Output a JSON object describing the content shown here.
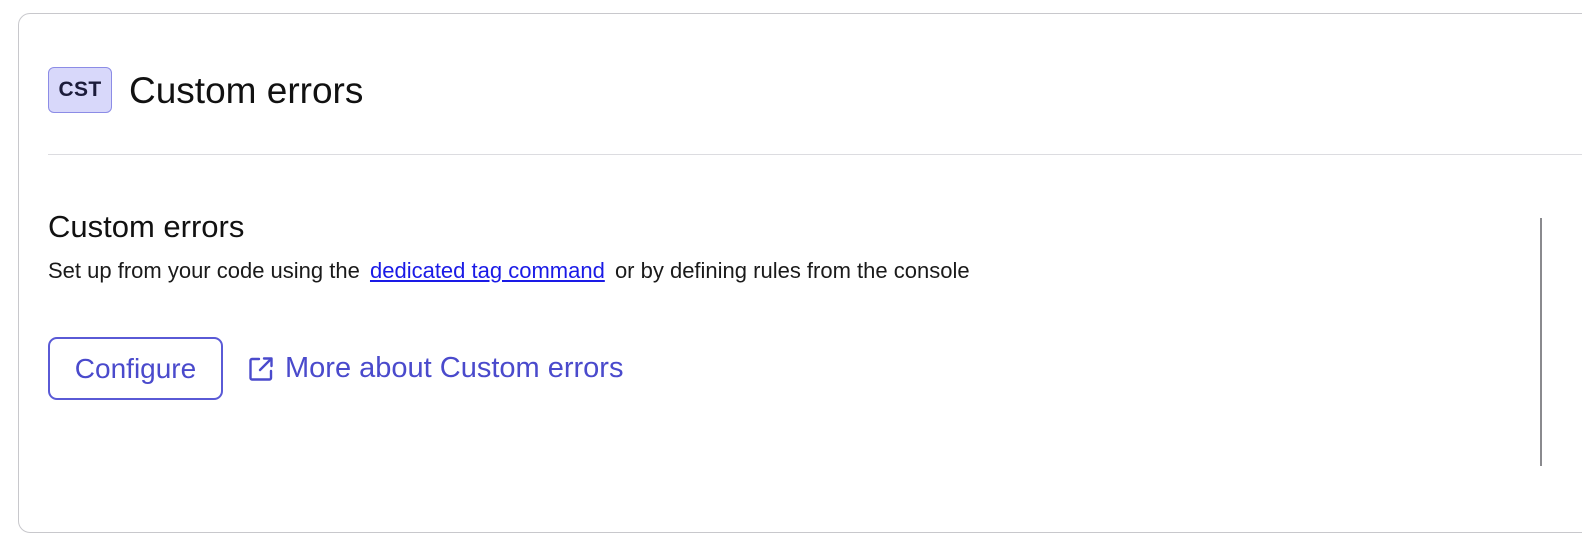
{
  "header": {
    "badge": "CST",
    "title": "Custom errors"
  },
  "section": {
    "title": "Custom errors",
    "description_before": "Set up from your code using the",
    "description_link": "dedicated tag command",
    "description_after": "or by defining rules from the console"
  },
  "actions": {
    "configure_label": "Configure",
    "more_label": "More about Custom errors",
    "more_icon": "external-link-icon"
  },
  "colors": {
    "accent": "#4a4acc",
    "badge_background": "#d8d8fa",
    "badge_border": "#8c8ce6",
    "link": "#1a1ae6"
  }
}
